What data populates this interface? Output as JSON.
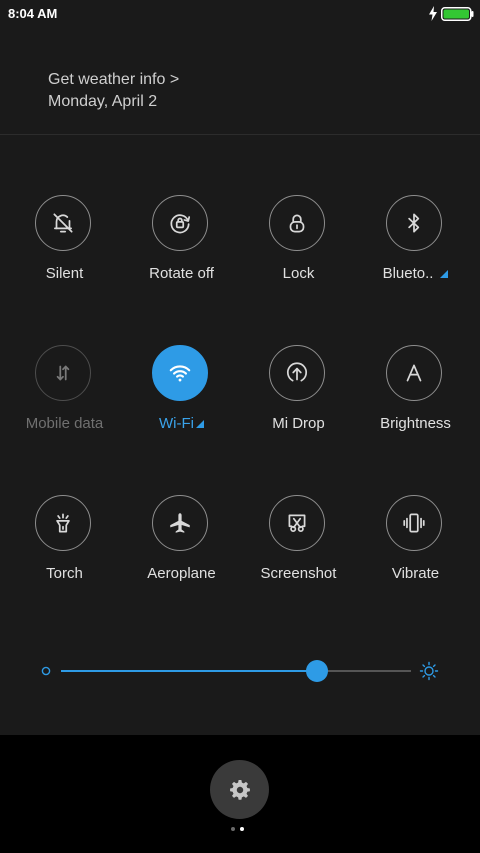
{
  "status_bar": {
    "time": "8:04 AM",
    "battery_color": "#33c733",
    "icons": [
      "charging-bolt-icon",
      "battery-icon"
    ]
  },
  "header": {
    "weather_link": "Get weather info >",
    "date": "Monday, April 2"
  },
  "toggles": [
    {
      "label": "Silent",
      "icon": "bell-off-icon",
      "state": "off"
    },
    {
      "label": "Rotate off",
      "icon": "rotate-lock-icon",
      "state": "off"
    },
    {
      "label": "Lock",
      "icon": "lock-icon",
      "state": "off"
    },
    {
      "label": "Blueto..",
      "icon": "bluetooth-icon",
      "state": "off",
      "has_more": true
    },
    {
      "label": "Mobile data",
      "icon": "mobile-data-icon",
      "state": "disabled"
    },
    {
      "label": "Wi-Fi",
      "icon": "wifi-icon",
      "state": "on",
      "has_more": true
    },
    {
      "label": "Mi Drop",
      "icon": "mi-drop-icon",
      "state": "off"
    },
    {
      "label": "Brightness",
      "icon": "auto-brightness-icon",
      "state": "off"
    },
    {
      "label": "Torch",
      "icon": "torch-icon",
      "state": "off"
    },
    {
      "label": "Aeroplane",
      "icon": "airplane-icon",
      "state": "off"
    },
    {
      "label": "Screenshot",
      "icon": "screenshot-icon",
      "state": "off"
    },
    {
      "label": "Vibrate",
      "icon": "vibrate-icon",
      "state": "off"
    }
  ],
  "brightness_slider": {
    "level": 0.73,
    "accent_color": "#2e9be6",
    "min_icon": "sun-low-icon",
    "max_icon": "sun-high-icon"
  },
  "footer": {
    "settings_icon": "gear-icon",
    "pages": 2,
    "active_page": 1
  }
}
